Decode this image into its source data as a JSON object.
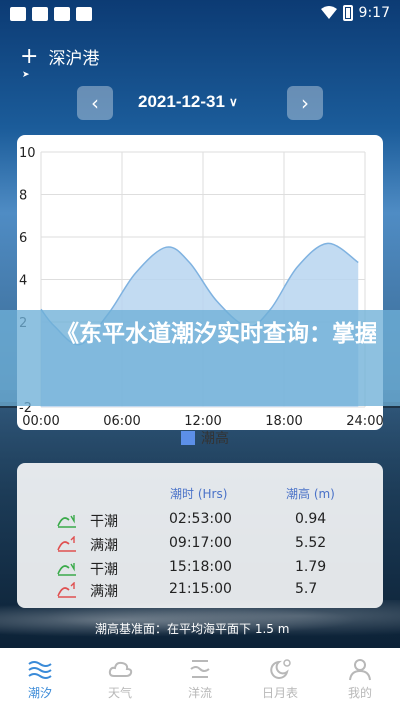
{
  "status_bar": {
    "time": "9:17"
  },
  "location": {
    "name": "深沪港"
  },
  "date_nav": {
    "date": "2021-12-31"
  },
  "chart_data": {
    "type": "area",
    "x_ticks": [
      "00:00",
      "06:00",
      "12:00",
      "18:00",
      "24:00"
    ],
    "y_ticks": [
      "10",
      "8",
      "6",
      "4",
      "2",
      "-2"
    ],
    "ylim": [
      -2,
      10
    ],
    "xlim": [
      0,
      24
    ],
    "series": [
      {
        "name": "潮高",
        "color": "#5c8fe8",
        "x": [
          0,
          1,
          2.88,
          5,
          7,
          9.28,
          11,
          13,
          15.3,
          17,
          19,
          21.25,
          23.5
        ],
        "y": [
          2.6,
          1.8,
          0.94,
          2.4,
          4.3,
          5.52,
          4.8,
          3.0,
          1.79,
          2.6,
          4.6,
          5.7,
          4.8
        ]
      }
    ],
    "legend": "bottom"
  },
  "banner": {
    "text": "《东平水道潮汐实时查询：掌握海洋节奏，畅"
  },
  "table": {
    "headers": {
      "time": "潮时 (Hrs)",
      "height": "潮高 (m)"
    },
    "rows": [
      {
        "type": "干潮",
        "time": "02:53:00",
        "height": "0.94",
        "icon_color": "#3aaa4a"
      },
      {
        "type": "满潮",
        "time": "09:17:00",
        "height": "5.52",
        "icon_color": "#e05050"
      },
      {
        "type": "干潮",
        "time": "15:18:00",
        "height": "1.79",
        "icon_color": "#3aaa4a"
      },
      {
        "type": "满潮",
        "time": "21:15:00",
        "height": "5.7",
        "icon_color": "#e05050"
      }
    ]
  },
  "datum": {
    "text": "潮高基准面：在平均海平面下 1.5 m"
  },
  "bottom_nav": [
    {
      "label": "潮汐",
      "icon": "waves-icon",
      "active": true
    },
    {
      "label": "天气",
      "icon": "cloud-icon",
      "active": false
    },
    {
      "label": "洋流",
      "icon": "current-icon",
      "active": false
    },
    {
      "label": "日月表",
      "icon": "sun-moon-icon",
      "active": false
    },
    {
      "label": "我的",
      "icon": "person-icon",
      "active": false
    }
  ],
  "colors": {
    "accent": "#3b8bd8",
    "chart_fill": "#b7d5f0",
    "chart_line": "#7fb2e0"
  }
}
